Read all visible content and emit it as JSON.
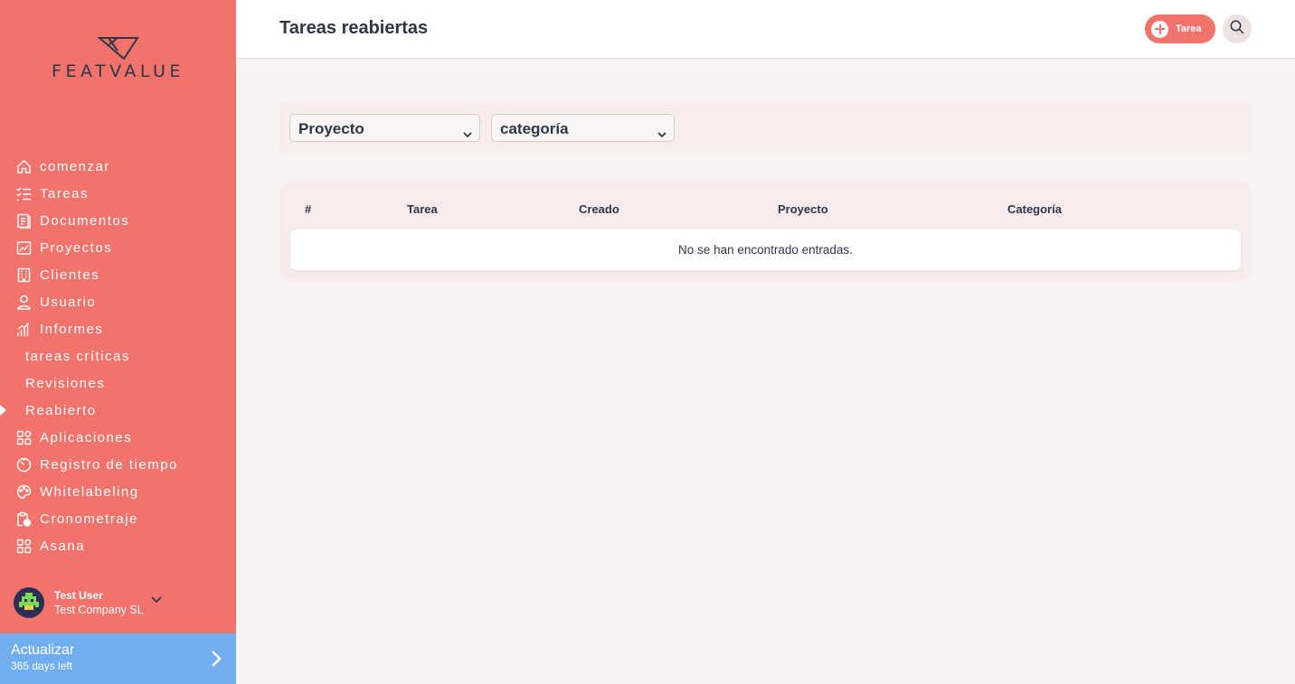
{
  "brand": {
    "name": "FEATVALUE"
  },
  "sidebar": {
    "items": [
      {
        "label": "comenzar",
        "icon": "home-icon"
      },
      {
        "label": "Tareas",
        "icon": "checklist-icon"
      },
      {
        "label": "Documentos",
        "icon": "document-icon"
      },
      {
        "label": "Proyectos",
        "icon": "chart-icon"
      },
      {
        "label": "Clientes",
        "icon": "building-icon"
      },
      {
        "label": "Usuario",
        "icon": "user-icon"
      },
      {
        "label": "Informes",
        "icon": "bar-chart-icon"
      },
      {
        "label": "tareas críticas"
      },
      {
        "label": "Revisiones"
      },
      {
        "label": "Reabierto",
        "active": true
      },
      {
        "label": "Aplicaciones",
        "icon": "apps-icon"
      },
      {
        "label": "Registro de tiempo",
        "icon": "timer-icon"
      },
      {
        "label": "Whitelabeling",
        "icon": "palette-icon"
      },
      {
        "label": "Cronometraje",
        "icon": "clipboard-clock-icon"
      },
      {
        "label": "Asana",
        "icon": "apps-icon"
      }
    ],
    "user": {
      "name": "Test User",
      "company": "Test Company SL"
    },
    "upgrade": {
      "title": "Actualizar",
      "subtitle": "365 days left"
    }
  },
  "header": {
    "title": "Tareas reabiertas",
    "task_button": "Tarea"
  },
  "filters": {
    "project": "Proyecto",
    "category": "categoría"
  },
  "table": {
    "columns": [
      "#",
      "Tarea",
      "Creado",
      "Proyecto",
      "Categoría"
    ],
    "empty_message": "No se han encontrado entradas."
  },
  "colors": {
    "sidebar": "#f2736b",
    "upgrade": "#70aef0",
    "text": "#2d3748"
  }
}
